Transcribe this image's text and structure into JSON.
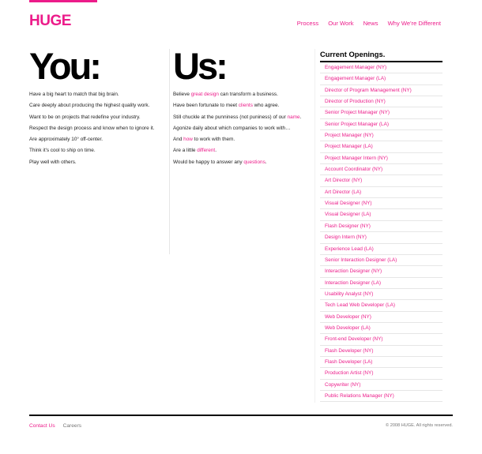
{
  "header": {
    "logo": "HUGE",
    "nav": [
      "Process",
      "Our Work",
      "News",
      "Why We're Different"
    ]
  },
  "you": {
    "title": "You:",
    "lines": [
      "Have a big heart to match that big brain.",
      "Care deeply about producing the highest quality work.",
      "Want to be on projects that redefine your industry.",
      "Respect the design process and know when to ignore it.",
      "Are approximately 10° off-center.",
      "Think it's cool to ship on time.",
      "Play well with others."
    ]
  },
  "us": {
    "title": "Us:",
    "lines": [
      {
        "before": "Believe ",
        "link": "great design",
        "after": " can transform a business."
      },
      {
        "before": "Have been fortunate to meet ",
        "link": "clients",
        "after": " who agree."
      },
      {
        "before": "Still chuckle at the punniness (not puniness) of our ",
        "link": "name",
        "after": "."
      },
      {
        "before": "Agonize daily about which companies to work with…",
        "link": "",
        "after": ""
      },
      {
        "before": "And ",
        "link": "how",
        "after": " to work with them."
      },
      {
        "before": "Are a little ",
        "link": "different",
        "after": "."
      },
      {
        "before": "Would be happy to answer any ",
        "link": "questions",
        "after": "."
      }
    ]
  },
  "openings": {
    "title": "Current Openings.",
    "jobs": [
      "Engagement Manager (NY)",
      "Engagement Manager (LA)",
      "Director of Program Management (NY)",
      "Director of Production (NY)",
      "Senior Project Manager (NY)",
      "Senior Project Manager (LA)",
      "Project Manager (NY)",
      "Project Manager (LA)",
      "Project Manager Intern (NY)",
      "Account Coordinator (NY)",
      "Art Director (NY)",
      "Art Director (LA)",
      "Visual Designer (NY)",
      "Visual Designer (LA)",
      "Flash Designer (NY)",
      "Design Intern (NY)",
      "Experience Lead (LA)",
      "Senior Interaction Designer (LA)",
      "Interaction Designer (NY)",
      "Interaction Designer (LA)",
      "Usability Analyst (NY)",
      "Tech Lead Web Developer (LA)",
      "Web Developer (NY)",
      "Web Developer (LA)",
      "Front-end Developer (NY)",
      "Flash Developer (NY)",
      "Flash Developer (LA)",
      "Production Artist (NY)",
      "Copywriter (NY)",
      "Public Relations Manager (NY)"
    ]
  },
  "footer": {
    "contact": "Contact Us",
    "careers": "Careers",
    "copyright": "© 2008 HUGE. All rights reserved."
  },
  "colors": {
    "accent": "#ec1c8a",
    "text": "#222222",
    "rule": "#e6e6e6"
  }
}
